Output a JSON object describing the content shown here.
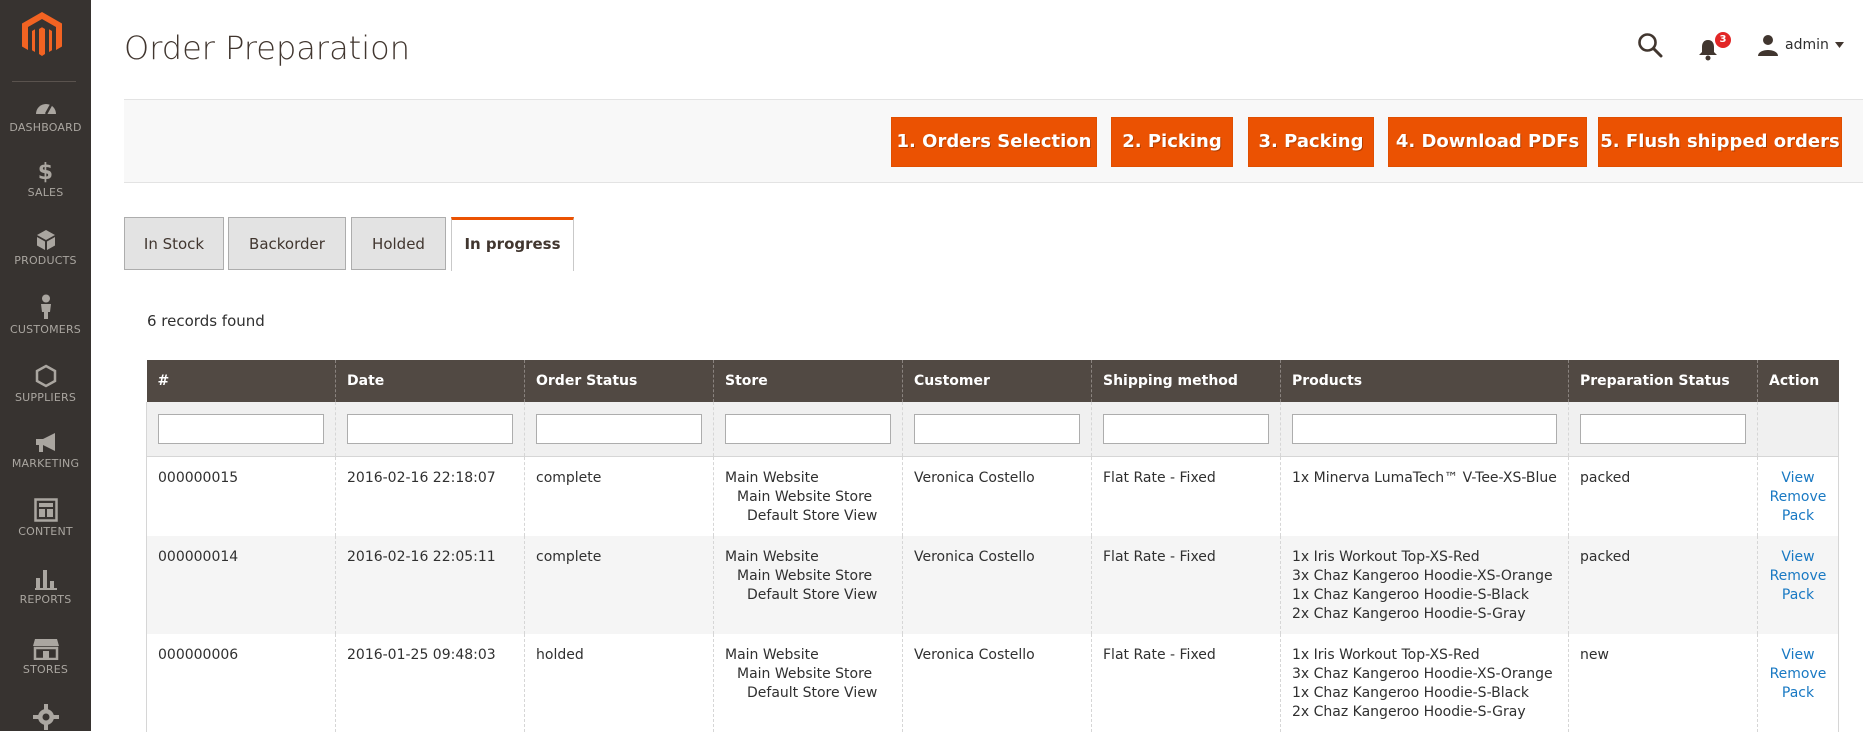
{
  "sidebar": {
    "items": [
      {
        "label": "DASHBOARD",
        "icon": "dashboard-icon"
      },
      {
        "label": "SALES",
        "icon": "dollar-icon"
      },
      {
        "label": "PRODUCTS",
        "icon": "cube-icon"
      },
      {
        "label": "CUSTOMERS",
        "icon": "person-icon"
      },
      {
        "label": "SUPPLIERS",
        "icon": "hexagon-icon"
      },
      {
        "label": "MARKETING",
        "icon": "megaphone-icon"
      },
      {
        "label": "CONTENT",
        "icon": "layout-icon"
      },
      {
        "label": "REPORTS",
        "icon": "bar-chart-icon"
      },
      {
        "label": "STORES",
        "icon": "store-icon"
      },
      {
        "label": "",
        "icon": "gear-icon"
      }
    ]
  },
  "header": {
    "title": "Order Preparation",
    "notifications_count": "3",
    "user_name": "admin"
  },
  "toolbar": {
    "buttons": [
      {
        "label": "1. Orders Selection"
      },
      {
        "label": "2. Picking"
      },
      {
        "label": "3. Packing"
      },
      {
        "label": "4. Download PDFs"
      },
      {
        "label": "5. Flush shipped orders"
      }
    ]
  },
  "tabs": [
    {
      "label": "In Stock",
      "active": false
    },
    {
      "label": "Backorder",
      "active": false
    },
    {
      "label": "Holded",
      "active": false
    },
    {
      "label": "In progress",
      "active": true
    }
  ],
  "records_text": "6 records found",
  "table": {
    "columns": [
      "#",
      "Date",
      "Order Status",
      "Store",
      "Customer",
      "Shipping method",
      "Products",
      "Preparation Status",
      "Action"
    ],
    "rows": [
      {
        "id": "000000015",
        "date": "2016-02-16 22:18:07",
        "status": "complete",
        "store": [
          "Main Website",
          "Main Website Store",
          "Default Store View"
        ],
        "customer": "Veronica Costello",
        "shipping": "Flat Rate - Fixed",
        "products": [
          "1x Minerva LumaTech™ V-Tee-XS-Blue"
        ],
        "prep_status": "packed",
        "actions": [
          "View",
          "Remove",
          "Pack"
        ]
      },
      {
        "id": "000000014",
        "date": "2016-02-16 22:05:11",
        "status": "complete",
        "store": [
          "Main Website",
          "Main Website Store",
          "Default Store View"
        ],
        "customer": "Veronica Costello",
        "shipping": "Flat Rate - Fixed",
        "products": [
          "1x Iris Workout Top-XS-Red",
          "3x Chaz Kangeroo Hoodie-XS-Orange",
          "1x Chaz Kangeroo Hoodie-S-Black",
          "2x Chaz Kangeroo Hoodie-S-Gray"
        ],
        "prep_status": "packed",
        "actions": [
          "View",
          "Remove",
          "Pack"
        ]
      },
      {
        "id": "000000006",
        "date": "2016-01-25 09:48:03",
        "status": "holded",
        "store": [
          "Main Website",
          "Main Website Store",
          "Default Store View"
        ],
        "customer": "Veronica Costello",
        "shipping": "Flat Rate - Fixed",
        "products": [
          "1x Iris Workout Top-XS-Red",
          "3x Chaz Kangeroo Hoodie-XS-Orange",
          "1x Chaz Kangeroo Hoodie-S-Black",
          "2x Chaz Kangeroo Hoodie-S-Gray"
        ],
        "prep_status": "new",
        "actions": [
          "View",
          "Remove",
          "Pack"
        ]
      }
    ]
  },
  "colors": {
    "accent": "#eb5202",
    "sidebar_bg": "#373330",
    "table_header_bg": "#514943",
    "link": "#1979c3",
    "badge": "#e22626"
  }
}
